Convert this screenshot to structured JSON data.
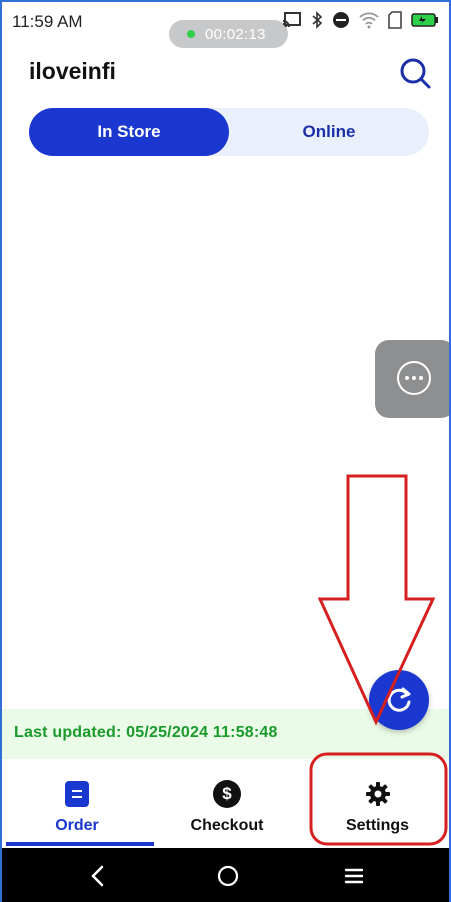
{
  "status_bar": {
    "time": "11:59 AM",
    "recording_timer": "00:02:13",
    "icons": [
      "cast-icon",
      "bluetooth-icon",
      "do-not-disturb-icon",
      "wifi-icon",
      "sim-icon",
      "battery-icon"
    ]
  },
  "header": {
    "title": "iloveinfi",
    "search_icon": "search-icon"
  },
  "segmented": {
    "tabs": [
      {
        "label": "In Store",
        "selected": true
      },
      {
        "label": "Online",
        "selected": false
      }
    ]
  },
  "floating": {
    "more_icon": "more-horizontal-icon",
    "refresh_icon": "refresh-icon"
  },
  "status": {
    "last_updated": "Last updated: 05/25/2024 11:58:48"
  },
  "bottom_nav": {
    "items": [
      {
        "label": "Order",
        "icon": "order-icon",
        "active": true
      },
      {
        "label": "Checkout",
        "icon": "dollar-icon",
        "active": false
      },
      {
        "label": "Settings",
        "icon": "gear-icon",
        "active": false
      }
    ]
  },
  "system_nav": {
    "icons": [
      "back-icon",
      "home-icon",
      "recents-icon"
    ]
  },
  "colors": {
    "primary": "#1a37cf",
    "success_text": "#1b9a2c",
    "success_bg": "#eafbe7",
    "annotation_red": "#d62020"
  }
}
